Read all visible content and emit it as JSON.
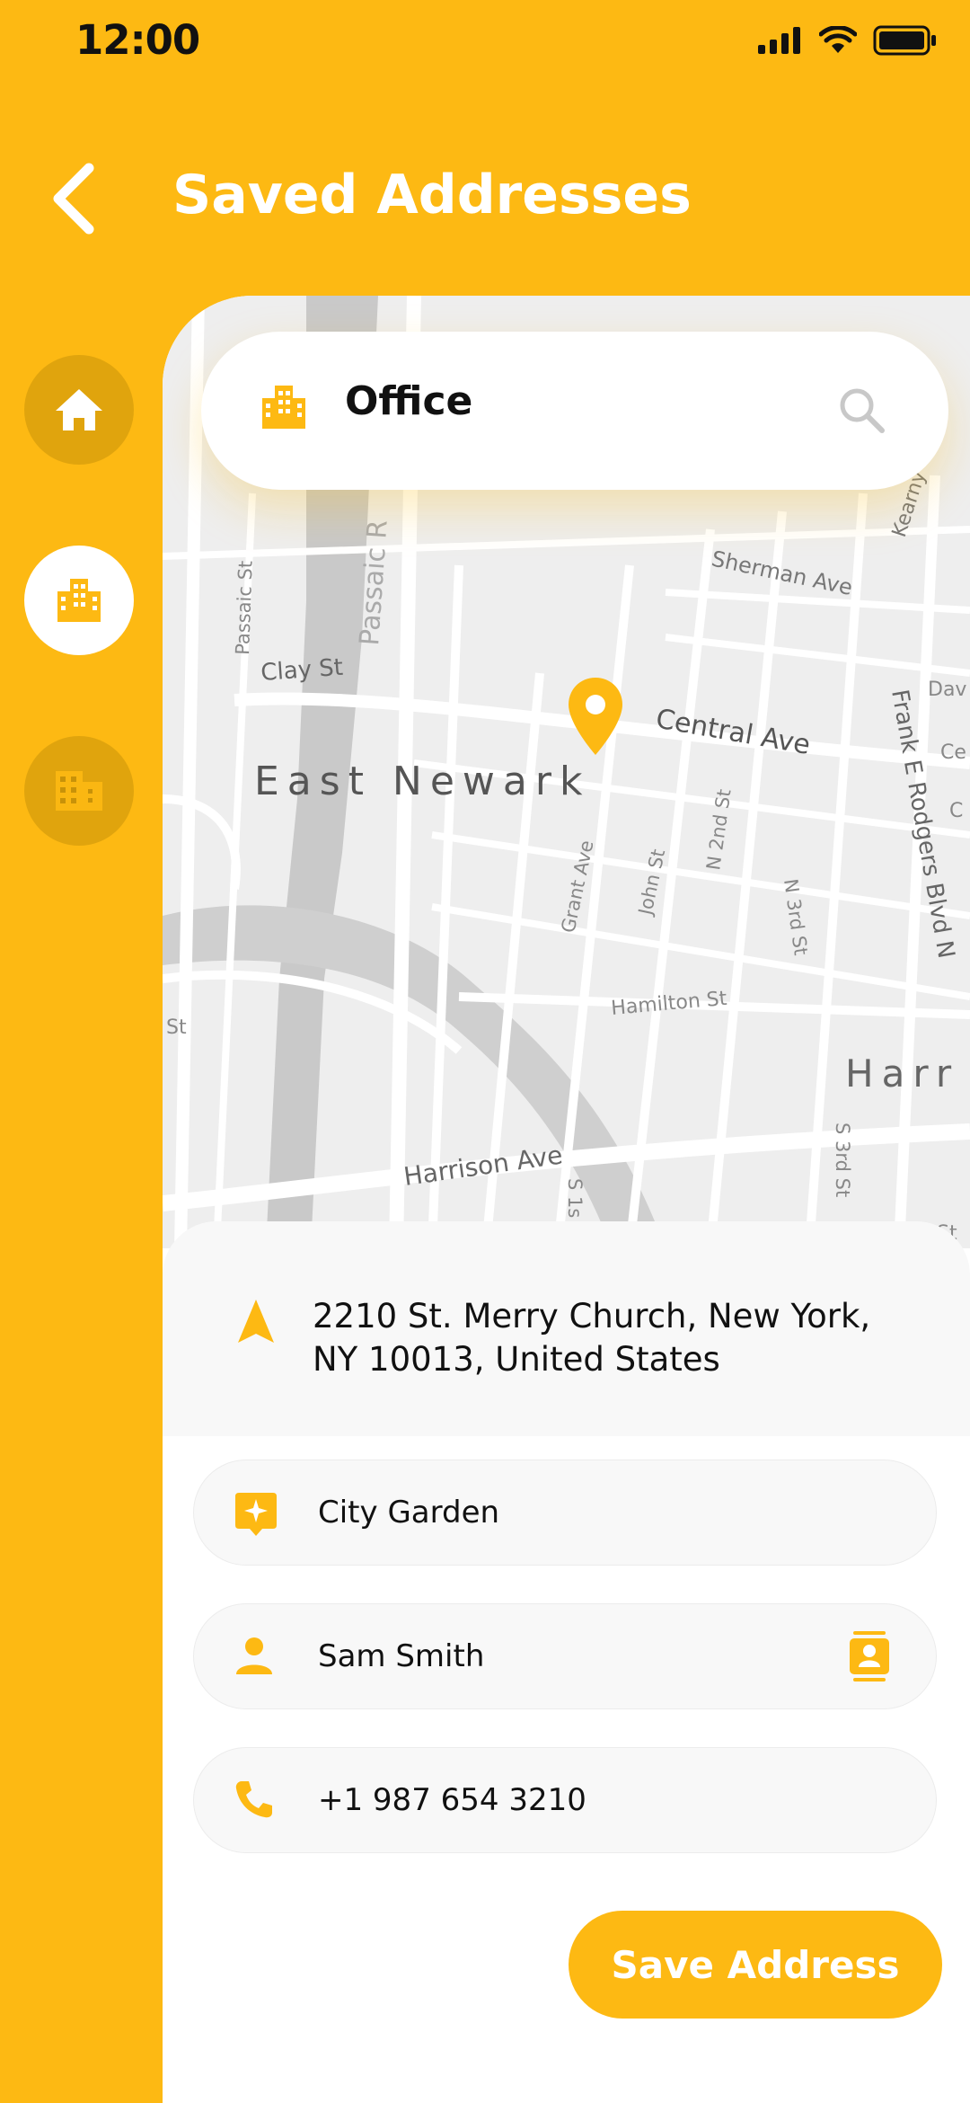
{
  "status_bar": {
    "time": "12:00"
  },
  "header": {
    "title": "Saved Addresses"
  },
  "rail": {
    "items": [
      {
        "icon": "home-icon",
        "active": false
      },
      {
        "icon": "office-building-icon",
        "active": true
      },
      {
        "icon": "apartment-building-icon",
        "active": false
      }
    ]
  },
  "search": {
    "label": "Office"
  },
  "map": {
    "labels": {
      "clay_st": "Clay St",
      "passaic_st": "Passaic St",
      "passaic_river": "Passaic R",
      "sherman_ave": "Sherman Ave",
      "central_ave": "Central Ave",
      "east_newark": "East Newark",
      "grant_ave": "Grant Ave",
      "john_st": "John St",
      "n_2nd_st": "N 2nd St",
      "n_3rd_st": "N 3rd St",
      "frank_e_rodgers": "Frank E Rodgers Blvd N",
      "hamilton_st": "Hamilton St",
      "harrison_ave": "Harrison Ave",
      "harr": "Harr",
      "s_3rd_st": "S 3rd St",
      "s_1st": "S 1s",
      "st_left": "St",
      "st_right": "St",
      "kearny": "Kearny",
      "dav": "Dav",
      "ce": "Ce",
      "c": "C"
    }
  },
  "address": {
    "line1": "2210 St. Merry Church, New York,",
    "line2": "NY 10013, United States"
  },
  "form": {
    "place_name": "City Garden",
    "contact_name": "Sam Smith",
    "phone": "+1 987 654 3210"
  },
  "actions": {
    "save_label": "Save Address"
  },
  "colors": {
    "accent": "#FDB913",
    "text": "#111111",
    "map_bg": "#ececec"
  }
}
